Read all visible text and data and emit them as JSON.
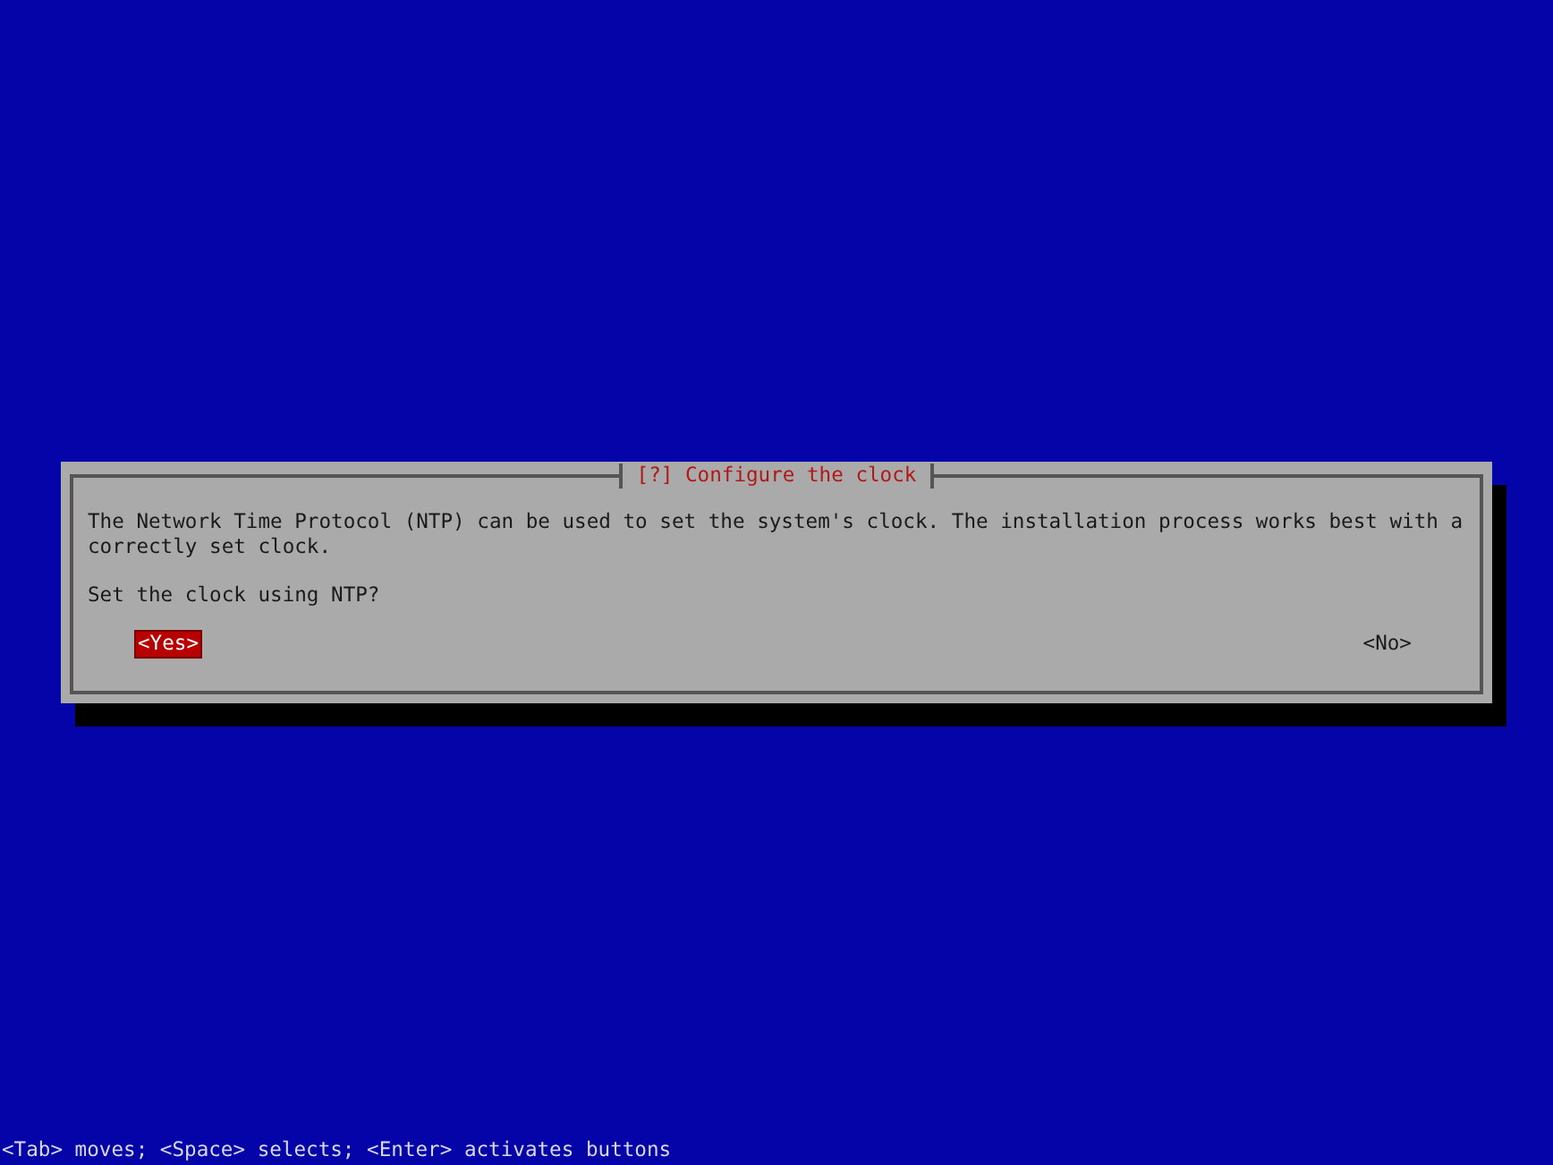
{
  "dialog": {
    "title": "[?] Configure the clock",
    "message": "The Network Time Protocol (NTP) can be used to set the system's clock. The installation process works best with a correctly set clock.",
    "question": "Set the clock using NTP?",
    "buttons": [
      {
        "label": "<Yes>",
        "selected": true
      },
      {
        "label": "<No>",
        "selected": false
      }
    ]
  },
  "status_bar": "<Tab> moves; <Space> selects; <Enter> activates buttons"
}
